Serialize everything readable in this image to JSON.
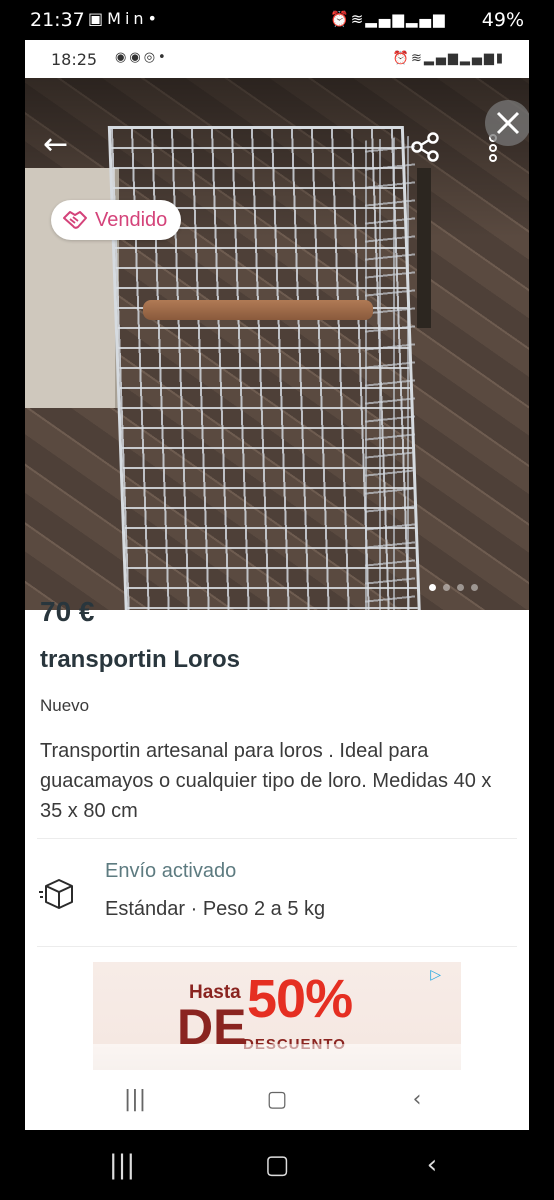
{
  "outer_status": {
    "time": "21:37",
    "battery": "49%",
    "notification_icons": [
      "image-icon",
      "gmail-icon",
      "linkedin-icon",
      "dot-icon"
    ],
    "system_icons": [
      "alarm-icon",
      "wifi-icon",
      "signal-icon",
      "signal-icon"
    ]
  },
  "inner_status": {
    "time": "18:25",
    "notification_icons": [
      "alert-icon",
      "alert-icon",
      "chrome-icon",
      "dot-icon"
    ],
    "system_icons": [
      "alarm-icon",
      "wifi-icon",
      "signal-icon",
      "signal-icon",
      "battery-icon"
    ]
  },
  "listing": {
    "sold_badge": "Vendido",
    "price": "70 €",
    "title": "transportin Loros",
    "condition": "Nuevo",
    "description": "Transportin artesanal para loros . Ideal para guacamayos o cualquier tipo de loro. Medidas 40 x 35 x 80 cm",
    "photo_count": 4,
    "active_photo": 1
  },
  "shipping": {
    "title": "Envío activado",
    "detail": "Estándar · Peso 2 a 5 kg"
  },
  "ad": {
    "hasta": "Hasta",
    "big": "50%",
    "de": "DE",
    "descuento": "DESCUENTO"
  },
  "colors": {
    "accent_pink": "#d4437a",
    "price_text": "#29363d",
    "shipping_title": "#5d7b80",
    "ad_red": "#e52f22"
  }
}
